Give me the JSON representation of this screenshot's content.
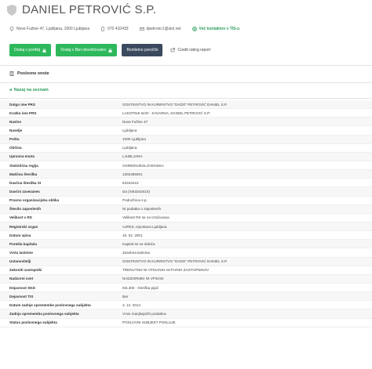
{
  "header": {
    "title": "DANIEL PETROVIĆ S.P.",
    "address": "Nove Fužine 47, Ljubljana, 1000 Ljubljana",
    "phone": "070 410433",
    "email": "dpetrovic1@siol.net",
    "contacts_link": "Več kontaktov v TIS-u"
  },
  "actions": {
    "add_portfolio": "Dodaj v portfelj",
    "add_notifier": "Dodaj v Bizi obveščevalec",
    "credit_report": "Bonitetno poročilo",
    "credit_rating": "Credit rating report"
  },
  "section": {
    "title": "Poslovne enote",
    "back": "Nazaj na seznam"
  },
  "details": [
    {
      "key": "Dolgo ime PRS",
      "value": "GOSTINSTVO IN KURIRSTVO \"DADO\" PETROVIĆ DANIEL S.P."
    },
    {
      "key": "Kratko ime PRS",
      "value": "LAKOTNIK BAR - KAVARNA, DANIEL PETROVIĆ S.P."
    },
    {
      "key": "Naslov",
      "value": "Nove Fužine 47"
    },
    {
      "key": "Naselje",
      "value": "Ljubljana"
    },
    {
      "key": "Pošta",
      "value": "1000 Ljubljana"
    },
    {
      "key": "Občina",
      "value": "Ljubljana"
    },
    {
      "key": "Upravna enota",
      "value": "LJUBLJANA"
    },
    {
      "key": "Statistična regija",
      "value": "OSREDNJESLOVENSKA"
    },
    {
      "key": "Matična številka",
      "value": "1302485001"
    },
    {
      "key": "Davčna številka SI",
      "value": "63343410"
    },
    {
      "key": "Davčni zavezanec",
      "value": "Da (SI63343410)"
    },
    {
      "key": "Pravno organizacijska oblika",
      "value": "Podružnica s.p."
    },
    {
      "key": "Število zaposlenih",
      "value": "Ni podatka o zaposlenih"
    },
    {
      "key": "Velikost v RS",
      "value": "Velikost RS se ne izračunava"
    },
    {
      "key": "Registrski organ",
      "value": "AJPES, Izpostava Ljubljana"
    },
    {
      "key": "Datum vpisa",
      "value": "16. 02. 2001"
    },
    {
      "key": "Porekla kapitala",
      "value": "Kapital se ne določa"
    },
    {
      "key": "Vrsta lastnine",
      "value": "Zasebna lastnina"
    },
    {
      "key": "Ustanovitelji",
      "value": "GOSTINSTVO IN KURIRSTVO \"DADO\" PETROVIĆ DANIEL S.P."
    },
    {
      "key": "Zakoniti zastopniki",
      "value": "TRENUTNO NI VPISANIH AKTIVNIH ZASTOPNIKOV"
    },
    {
      "key": "Nadzorni svet",
      "value": "NADZORNIKI NI VPISAN"
    },
    {
      "key": "Dejavnost SKD",
      "value": "I56.300 - Strežba pijač"
    },
    {
      "key": "Dejavnost TIS",
      "value": "Bar"
    },
    {
      "key": "Datum zadnje spremembe poslovnega subjekta",
      "value": "3. 12. 2014"
    },
    {
      "key": "Zadnja sprememba poslovnega subjekta",
      "value": "Vnos manjkajočih podatkov"
    },
    {
      "key": "Status poslovnega subjekta",
      "value": "POSLOVNI SUBJEKT POSLUJE"
    }
  ]
}
